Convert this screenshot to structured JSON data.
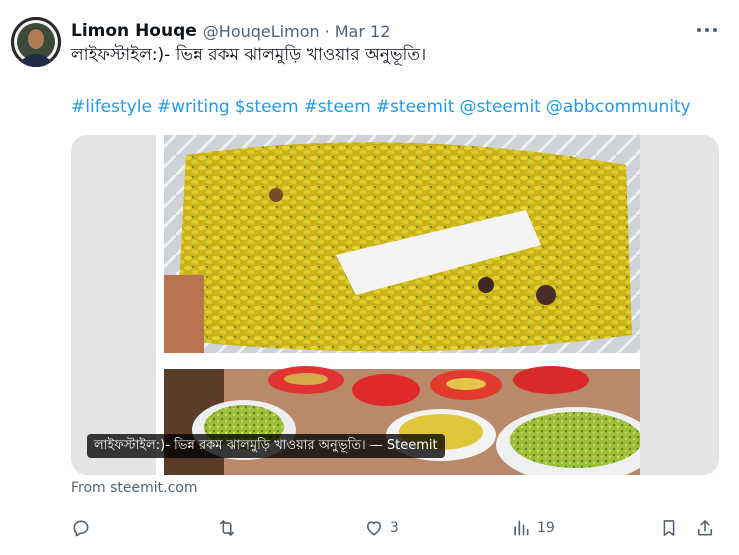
{
  "tweet": {
    "display_name": "Limon Houqe",
    "handle": "@HouqeLimon",
    "separator": "·",
    "date": "Mar 12",
    "text": "লাইফস্টাইল:)- ভিন্ন রকম ঝালমুড়ি খাওয়ার অনুভূতি।",
    "hashtags": [
      "#lifestyle",
      "#writing",
      "$steem",
      "#steem",
      "#steemit",
      "@steemit",
      "@abbcommunity"
    ],
    "card": {
      "title": "লাইফস্টাইল:)- ভিন্ন রকম ঝালমুড়ি খাওয়ার অনুভূতি। — Steemit",
      "source": "From steemit.com"
    },
    "actions": {
      "reply": {
        "icon": "reply-icon",
        "count": ""
      },
      "retweet": {
        "icon": "retweet-icon",
        "count": ""
      },
      "like": {
        "icon": "heart-icon",
        "count": "3"
      },
      "views": {
        "icon": "views-icon",
        "count": "19"
      },
      "bookmark": {
        "icon": "bookmark-icon"
      },
      "share": {
        "icon": "share-icon"
      }
    }
  },
  "colors": {
    "link": "#1d9bf0",
    "muted": "#536471",
    "text": "#0f1419"
  }
}
